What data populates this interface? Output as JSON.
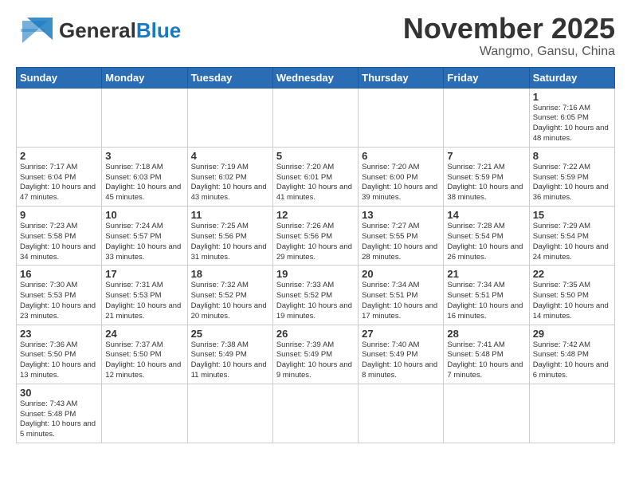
{
  "header": {
    "logo_general": "General",
    "logo_blue": "Blue",
    "month_title": "November 2025",
    "location": "Wangmo, Gansu, China"
  },
  "weekdays": [
    "Sunday",
    "Monday",
    "Tuesday",
    "Wednesday",
    "Thursday",
    "Friday",
    "Saturday"
  ],
  "days": {
    "d1": {
      "num": "1",
      "sunrise": "Sunrise: 7:16 AM",
      "sunset": "Sunset: 6:05 PM",
      "daylight": "Daylight: 10 hours and 48 minutes."
    },
    "d2": {
      "num": "2",
      "sunrise": "Sunrise: 7:17 AM",
      "sunset": "Sunset: 6:04 PM",
      "daylight": "Daylight: 10 hours and 47 minutes."
    },
    "d3": {
      "num": "3",
      "sunrise": "Sunrise: 7:18 AM",
      "sunset": "Sunset: 6:03 PM",
      "daylight": "Daylight: 10 hours and 45 minutes."
    },
    "d4": {
      "num": "4",
      "sunrise": "Sunrise: 7:19 AM",
      "sunset": "Sunset: 6:02 PM",
      "daylight": "Daylight: 10 hours and 43 minutes."
    },
    "d5": {
      "num": "5",
      "sunrise": "Sunrise: 7:20 AM",
      "sunset": "Sunset: 6:01 PM",
      "daylight": "Daylight: 10 hours and 41 minutes."
    },
    "d6": {
      "num": "6",
      "sunrise": "Sunrise: 7:20 AM",
      "sunset": "Sunset: 6:00 PM",
      "daylight": "Daylight: 10 hours and 39 minutes."
    },
    "d7": {
      "num": "7",
      "sunrise": "Sunrise: 7:21 AM",
      "sunset": "Sunset: 5:59 PM",
      "daylight": "Daylight: 10 hours and 38 minutes."
    },
    "d8": {
      "num": "8",
      "sunrise": "Sunrise: 7:22 AM",
      "sunset": "Sunset: 5:59 PM",
      "daylight": "Daylight: 10 hours and 36 minutes."
    },
    "d9": {
      "num": "9",
      "sunrise": "Sunrise: 7:23 AM",
      "sunset": "Sunset: 5:58 PM",
      "daylight": "Daylight: 10 hours and 34 minutes."
    },
    "d10": {
      "num": "10",
      "sunrise": "Sunrise: 7:24 AM",
      "sunset": "Sunset: 5:57 PM",
      "daylight": "Daylight: 10 hours and 33 minutes."
    },
    "d11": {
      "num": "11",
      "sunrise": "Sunrise: 7:25 AM",
      "sunset": "Sunset: 5:56 PM",
      "daylight": "Daylight: 10 hours and 31 minutes."
    },
    "d12": {
      "num": "12",
      "sunrise": "Sunrise: 7:26 AM",
      "sunset": "Sunset: 5:56 PM",
      "daylight": "Daylight: 10 hours and 29 minutes."
    },
    "d13": {
      "num": "13",
      "sunrise": "Sunrise: 7:27 AM",
      "sunset": "Sunset: 5:55 PM",
      "daylight": "Daylight: 10 hours and 28 minutes."
    },
    "d14": {
      "num": "14",
      "sunrise": "Sunrise: 7:28 AM",
      "sunset": "Sunset: 5:54 PM",
      "daylight": "Daylight: 10 hours and 26 minutes."
    },
    "d15": {
      "num": "15",
      "sunrise": "Sunrise: 7:29 AM",
      "sunset": "Sunset: 5:54 PM",
      "daylight": "Daylight: 10 hours and 24 minutes."
    },
    "d16": {
      "num": "16",
      "sunrise": "Sunrise: 7:30 AM",
      "sunset": "Sunset: 5:53 PM",
      "daylight": "Daylight: 10 hours and 23 minutes."
    },
    "d17": {
      "num": "17",
      "sunrise": "Sunrise: 7:31 AM",
      "sunset": "Sunset: 5:53 PM",
      "daylight": "Daylight: 10 hours and 21 minutes."
    },
    "d18": {
      "num": "18",
      "sunrise": "Sunrise: 7:32 AM",
      "sunset": "Sunset: 5:52 PM",
      "daylight": "Daylight: 10 hours and 20 minutes."
    },
    "d19": {
      "num": "19",
      "sunrise": "Sunrise: 7:33 AM",
      "sunset": "Sunset: 5:52 PM",
      "daylight": "Daylight: 10 hours and 19 minutes."
    },
    "d20": {
      "num": "20",
      "sunrise": "Sunrise: 7:34 AM",
      "sunset": "Sunset: 5:51 PM",
      "daylight": "Daylight: 10 hours and 17 minutes."
    },
    "d21": {
      "num": "21",
      "sunrise": "Sunrise: 7:34 AM",
      "sunset": "Sunset: 5:51 PM",
      "daylight": "Daylight: 10 hours and 16 minutes."
    },
    "d22": {
      "num": "22",
      "sunrise": "Sunrise: 7:35 AM",
      "sunset": "Sunset: 5:50 PM",
      "daylight": "Daylight: 10 hours and 14 minutes."
    },
    "d23": {
      "num": "23",
      "sunrise": "Sunrise: 7:36 AM",
      "sunset": "Sunset: 5:50 PM",
      "daylight": "Daylight: 10 hours and 13 minutes."
    },
    "d24": {
      "num": "24",
      "sunrise": "Sunrise: 7:37 AM",
      "sunset": "Sunset: 5:50 PM",
      "daylight": "Daylight: 10 hours and 12 minutes."
    },
    "d25": {
      "num": "25",
      "sunrise": "Sunrise: 7:38 AM",
      "sunset": "Sunset: 5:49 PM",
      "daylight": "Daylight: 10 hours and 11 minutes."
    },
    "d26": {
      "num": "26",
      "sunrise": "Sunrise: 7:39 AM",
      "sunset": "Sunset: 5:49 PM",
      "daylight": "Daylight: 10 hours and 9 minutes."
    },
    "d27": {
      "num": "27",
      "sunrise": "Sunrise: 7:40 AM",
      "sunset": "Sunset: 5:49 PM",
      "daylight": "Daylight: 10 hours and 8 minutes."
    },
    "d28": {
      "num": "28",
      "sunrise": "Sunrise: 7:41 AM",
      "sunset": "Sunset: 5:48 PM",
      "daylight": "Daylight: 10 hours and 7 minutes."
    },
    "d29": {
      "num": "29",
      "sunrise": "Sunrise: 7:42 AM",
      "sunset": "Sunset: 5:48 PM",
      "daylight": "Daylight: 10 hours and 6 minutes."
    },
    "d30": {
      "num": "30",
      "sunrise": "Sunrise: 7:43 AM",
      "sunset": "Sunset: 5:48 PM",
      "daylight": "Daylight: 10 hours and 5 minutes."
    }
  }
}
